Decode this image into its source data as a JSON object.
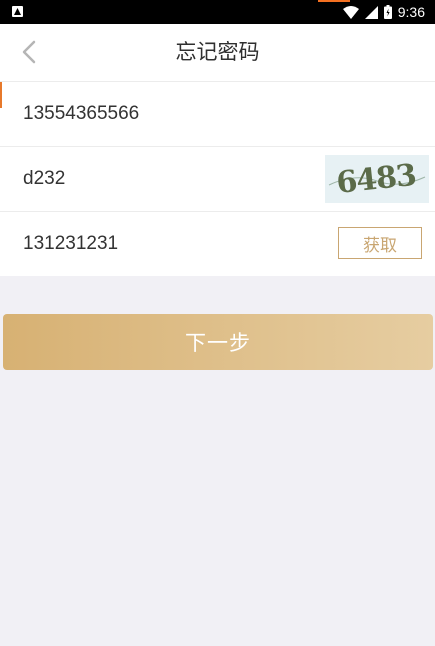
{
  "status_bar": {
    "time": "9:36",
    "icons": [
      "notification-icon",
      "wifi-icon",
      "signal-icon",
      "battery-icon"
    ]
  },
  "header": {
    "title": "忘记密码",
    "back_icon": "chevron-left-icon"
  },
  "form": {
    "phone_value": "13554365566",
    "captcha_value": "d232",
    "captcha_image_text": "6483",
    "sms_code_value": "131231231",
    "get_code_label": "获取"
  },
  "actions": {
    "next_label": "下一步"
  },
  "colors": {
    "accent_gold": "#c9a672",
    "button_gradient_start": "#d7b173",
    "button_gradient_end": "#e6cda1",
    "background": "#f1f0f5"
  }
}
